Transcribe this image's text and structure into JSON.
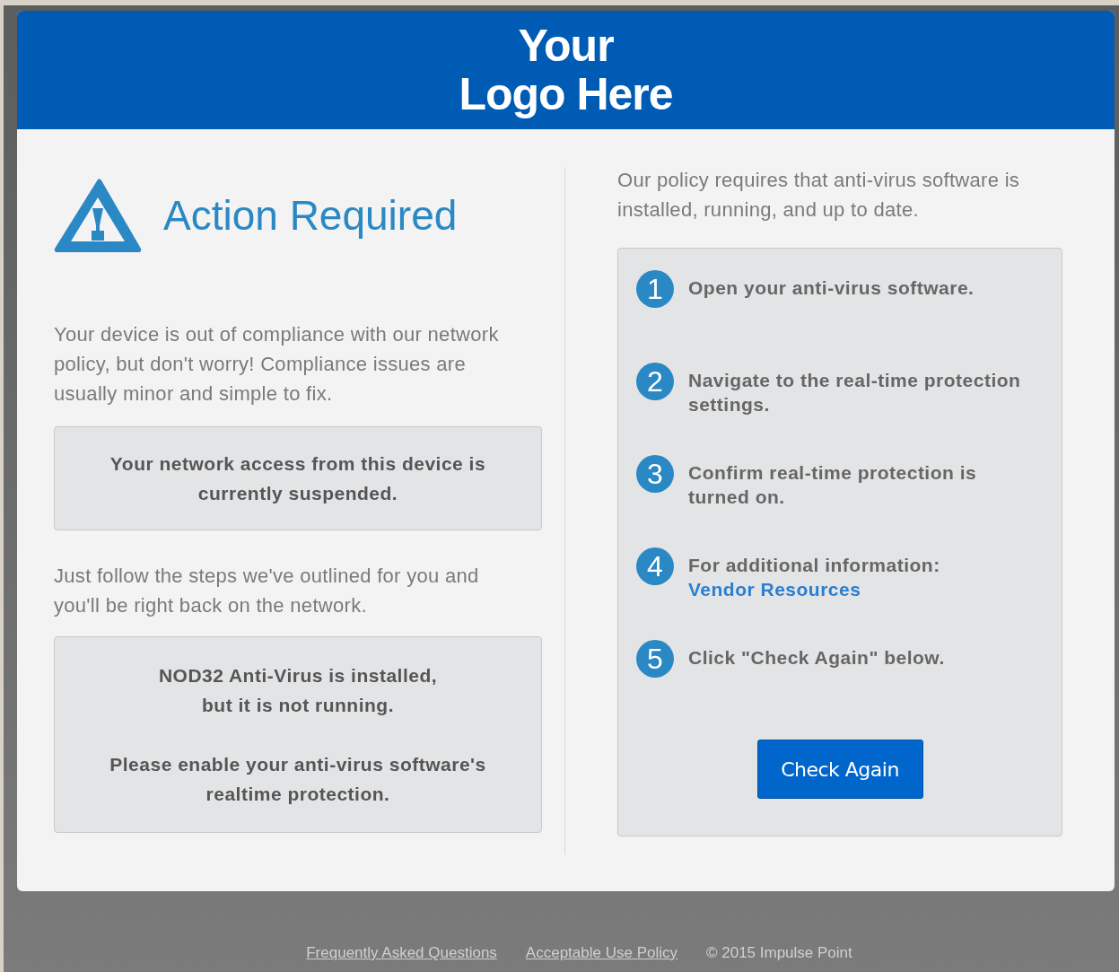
{
  "header": {
    "logo_line_1": "Your",
    "logo_line_2": "Logo Here"
  },
  "left": {
    "title": "Action Required",
    "intro": "Your device is out of compliance with our network policy, but don't worry! Compliance issues are usually minor and simple to fix.",
    "notice": "Your network access from this device is currently suspended.",
    "follow": "Just follow the steps we've outlined for you and you'll be right back on the network.",
    "status_lines": [
      "NOD32 Anti-Virus is installed,",
      "but it is not running.",
      "Please enable your anti-virus software's realtime protection."
    ]
  },
  "right": {
    "policy": "Our policy requires that anti-virus software is installed, running, and up to date.",
    "steps": [
      {
        "number": "1",
        "text": "Open your anti-virus software."
      },
      {
        "number": "2",
        "text": "Navigate to the real-time protection settings."
      },
      {
        "number": "3",
        "text": "Confirm real-time protection is turned on."
      },
      {
        "number": "4",
        "text": "For additional information:",
        "link": "Vendor Resources"
      },
      {
        "number": "5",
        "text": "Click \"Check Again\" below."
      }
    ],
    "button": "Check Again"
  },
  "footer": {
    "links": [
      "Frequently Asked Questions",
      "Acceptable Use Policy"
    ],
    "copyright": "© 2015 Impulse Point"
  }
}
